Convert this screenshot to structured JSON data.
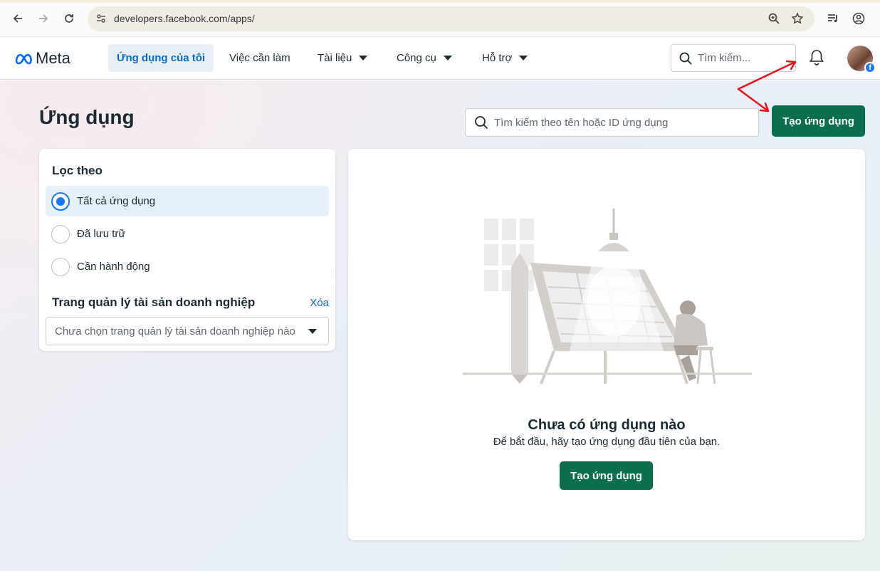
{
  "browser": {
    "url": "developers.facebook.com/apps/"
  },
  "nav": {
    "logo_text": "Meta",
    "items": [
      {
        "label": "Ứng dụng của tôi",
        "active": true,
        "dropdown": false
      },
      {
        "label": "Việc cần làm",
        "active": false,
        "dropdown": false
      },
      {
        "label": "Tài liệu",
        "active": false,
        "dropdown": true
      },
      {
        "label": "Công cụ",
        "active": false,
        "dropdown": true
      },
      {
        "label": "Hỗ trợ",
        "active": false,
        "dropdown": true
      }
    ],
    "search_placeholder": "Tìm kiếm..."
  },
  "page": {
    "title": "Ứng dụng",
    "search_placeholder": "Tìm kiếm theo tên hoặc ID ứng dụng",
    "create_button": "Tạo ứng dụng"
  },
  "filter": {
    "heading": "Lọc theo",
    "options": [
      {
        "label": "Tất cả ứng dụng",
        "selected": true
      },
      {
        "label": "Đã lưu trữ",
        "selected": false
      },
      {
        "label": "Cần hành động",
        "selected": false
      }
    ],
    "business_manager_title": "Trang quản lý tài sản doanh nghiệp",
    "clear_label": "Xóa",
    "business_manager_placeholder": "Chưa chọn trang quản lý tài sản doanh nghiệp nào"
  },
  "empty_state": {
    "title": "Chưa có ứng dụng nào",
    "subtitle": "Để bắt đầu, hãy tạo ứng dụng đầu tiên của bạn.",
    "button": "Tạo ứng dụng"
  },
  "colors": {
    "primary_green": "#0b6e4f",
    "accent_blue": "#1877f2",
    "annotation_red": "#e8121b"
  }
}
